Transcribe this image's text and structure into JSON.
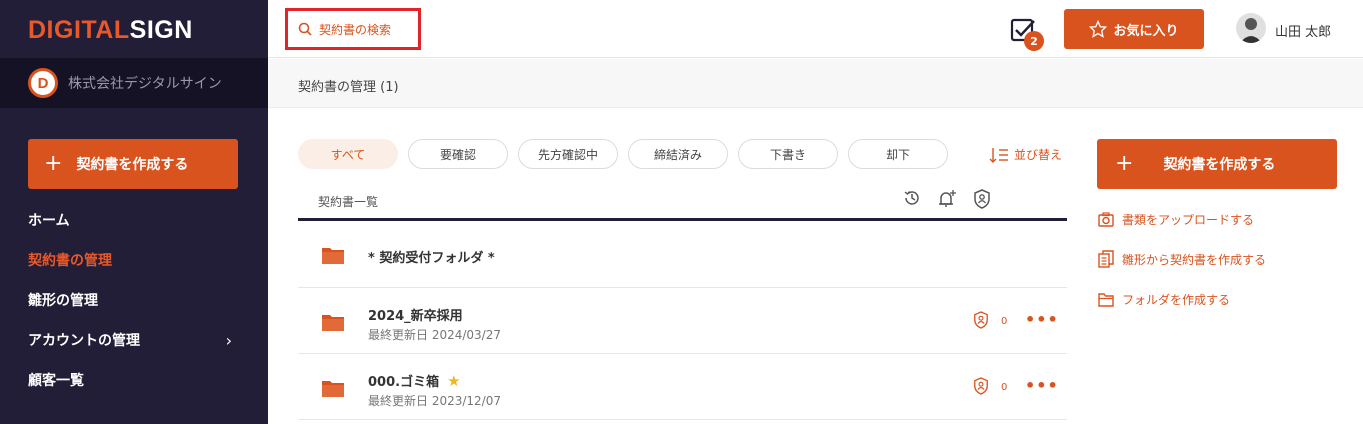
{
  "sidebar": {
    "logo_part1": "DIGITAL",
    "logo_part2": "SIGN",
    "company_initial": "D",
    "company_name": "株式会社デジタルサイン",
    "create_label": "契約書を作成する",
    "nav": [
      {
        "label": "ホーム"
      },
      {
        "label": "契約書の管理"
      },
      {
        "label": "雛形の管理"
      },
      {
        "label": "アカウントの管理"
      },
      {
        "label": "顧客一覧"
      }
    ]
  },
  "header": {
    "search_placeholder": "契約書の検索",
    "task_badge": "2",
    "favorite_label": "お気に入り",
    "user_name": "山田 太郎"
  },
  "page": {
    "title": "契約書の管理 (1)"
  },
  "filters": {
    "tabs": [
      "すべて",
      "要確認",
      "先方確認中",
      "締結済み",
      "下書き",
      "却下"
    ],
    "sort_label": "並び替え"
  },
  "list": {
    "header_label": "契約書一覧",
    "rows": [
      {
        "title": "* 契約受付フォルダ *"
      },
      {
        "title": "2024_新卒採用",
        "updated": "最終更新日 2024/03/27",
        "count": "0"
      },
      {
        "title": "000.ゴミ箱",
        "updated": "最終更新日 2023/12/07",
        "count": "0"
      }
    ]
  },
  "right_panel": {
    "create_label": "契約書を作成する",
    "actions": [
      {
        "label": "書類をアップロードする"
      },
      {
        "label": "雛形から契約書を作成する"
      },
      {
        "label": "フォルダを作成する"
      }
    ]
  },
  "colors": {
    "accent": "#d9531e",
    "sidebar_bg": "#221e38",
    "highlight": "#e0242a",
    "star": "#f3b51c"
  }
}
